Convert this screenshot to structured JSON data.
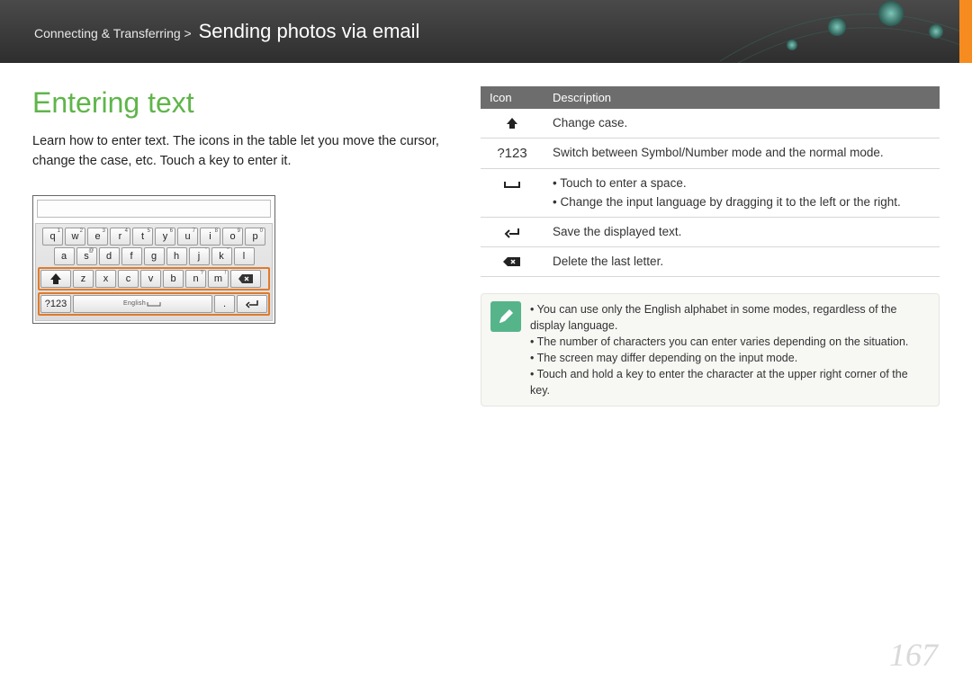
{
  "header": {
    "breadcrumb_prefix": "Connecting & Transferring >",
    "breadcrumb_title": "Sending photos via email"
  },
  "heading": "Entering text",
  "intro": "Learn how to enter text. The icons in the table let you move the cursor, change the case, etc. Touch a key to enter it.",
  "keyboard": {
    "row1": [
      {
        "k": "q",
        "s": "1"
      },
      {
        "k": "w",
        "s": "2"
      },
      {
        "k": "e",
        "s": "3"
      },
      {
        "k": "r",
        "s": "4"
      },
      {
        "k": "t",
        "s": "5"
      },
      {
        "k": "y",
        "s": "6"
      },
      {
        "k": "u",
        "s": "7"
      },
      {
        "k": "i",
        "s": "8"
      },
      {
        "k": "o",
        "s": "9"
      },
      {
        "k": "p",
        "s": "0"
      }
    ],
    "row2": [
      {
        "k": "a"
      },
      {
        "k": "s",
        "s": "@"
      },
      {
        "k": "d"
      },
      {
        "k": "f"
      },
      {
        "k": "g"
      },
      {
        "k": "h"
      },
      {
        "k": "j",
        "s": "'"
      },
      {
        "k": "k",
        "s": "\""
      },
      {
        "k": "l"
      }
    ],
    "row3": [
      {
        "icon": "shift"
      },
      {
        "k": "z"
      },
      {
        "k": "x"
      },
      {
        "k": "c"
      },
      {
        "k": "v"
      },
      {
        "k": "b"
      },
      {
        "k": "n",
        "s": "?"
      },
      {
        "k": "m",
        "s": "!"
      },
      {
        "icon": "backspace"
      }
    ],
    "row4_symkey": "?123",
    "row4_lang": "English",
    "row4_period": "."
  },
  "icon_table": {
    "header_icon": "Icon",
    "header_desc": "Description",
    "rows": [
      {
        "icon": "shift",
        "desc_simple": "Change case."
      },
      {
        "icon": "sym",
        "icon_text": "?123",
        "desc_simple": "Switch between Symbol/Number mode and the normal mode."
      },
      {
        "icon": "space",
        "desc_list": [
          "Touch to enter a space.",
          "Change the input language by dragging it to the left or the right."
        ]
      },
      {
        "icon": "enter",
        "desc_simple": "Save the displayed text."
      },
      {
        "icon": "back",
        "desc_simple": "Delete the last letter."
      }
    ]
  },
  "notes": [
    "You can use only the English alphabet in some modes, regardless of the display language.",
    "The number of characters you can enter varies depending on the situation.",
    "The screen may differ depending on the input mode.",
    "Touch and hold a key to enter the character at the upper right corner of the key."
  ],
  "page_number": "167"
}
